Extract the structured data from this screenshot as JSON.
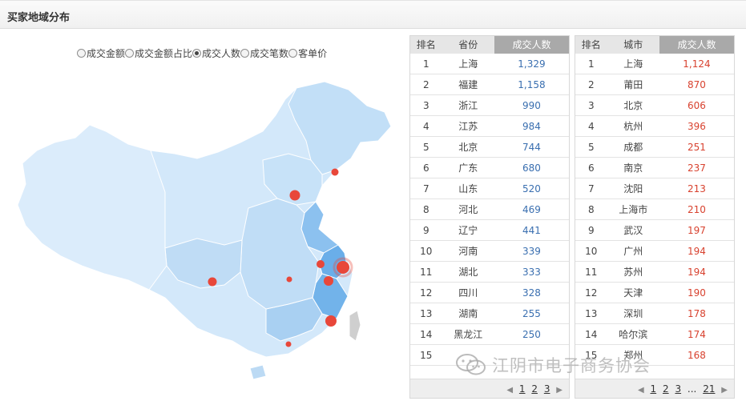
{
  "header": {
    "title": "买家地域分布"
  },
  "metric_options": [
    {
      "label": "成交金额",
      "checked": false
    },
    {
      "label": "成交金额占比",
      "checked": false
    },
    {
      "label": "成交人数",
      "checked": true
    },
    {
      "label": "成交笔数",
      "checked": false
    },
    {
      "label": "客单价",
      "checked": false
    }
  ],
  "province_table": {
    "headers": [
      "排名",
      "省份",
      "成交人数"
    ],
    "rows": [
      [
        "1",
        "上海",
        "1,329"
      ],
      [
        "2",
        "福建",
        "1,158"
      ],
      [
        "3",
        "浙江",
        "990"
      ],
      [
        "4",
        "江苏",
        "984"
      ],
      [
        "5",
        "北京",
        "744"
      ],
      [
        "6",
        "广东",
        "680"
      ],
      [
        "7",
        "山东",
        "520"
      ],
      [
        "8",
        "河北",
        "469"
      ],
      [
        "9",
        "辽宁",
        "441"
      ],
      [
        "10",
        "河南",
        "339"
      ],
      [
        "11",
        "湖北",
        "333"
      ],
      [
        "12",
        "四川",
        "328"
      ],
      [
        "13",
        "湖南",
        "255"
      ],
      [
        "14",
        "黑龙江",
        "250"
      ],
      [
        "15",
        "",
        ""
      ]
    ],
    "pager": {
      "pages": [
        "1",
        "2",
        "3"
      ]
    }
  },
  "city_table": {
    "headers": [
      "排名",
      "城市",
      "成交人数"
    ],
    "rows": [
      [
        "1",
        "上海",
        "1,124"
      ],
      [
        "2",
        "莆田",
        "870"
      ],
      [
        "3",
        "北京",
        "606"
      ],
      [
        "4",
        "杭州",
        "396"
      ],
      [
        "5",
        "成都",
        "251"
      ],
      [
        "6",
        "南京",
        "237"
      ],
      [
        "7",
        "沈阳",
        "213"
      ],
      [
        "8",
        "上海市",
        "210"
      ],
      [
        "9",
        "武汉",
        "197"
      ],
      [
        "10",
        "广州",
        "194"
      ],
      [
        "11",
        "苏州",
        "194"
      ],
      [
        "12",
        "天津",
        "190"
      ],
      [
        "13",
        "深圳",
        "178"
      ],
      [
        "14",
        "哈尔滨",
        "174"
      ],
      [
        "15",
        "郑州",
        "168"
      ]
    ],
    "pager": {
      "pages": [
        "1",
        "2",
        "3"
      ],
      "ellipsis": "...",
      "last": "21"
    }
  },
  "watermark": {
    "text": "江阴市电子商务协会",
    "icon": "wechat-icon"
  },
  "colors": {
    "map_fill_light": "#cfe6f8",
    "map_fill_mid": "#a8d0f2",
    "map_fill_dark": "#6aaee9",
    "marker": "#e8473a",
    "city_value": "#d8422f",
    "province_value": "#3a6fb0"
  }
}
